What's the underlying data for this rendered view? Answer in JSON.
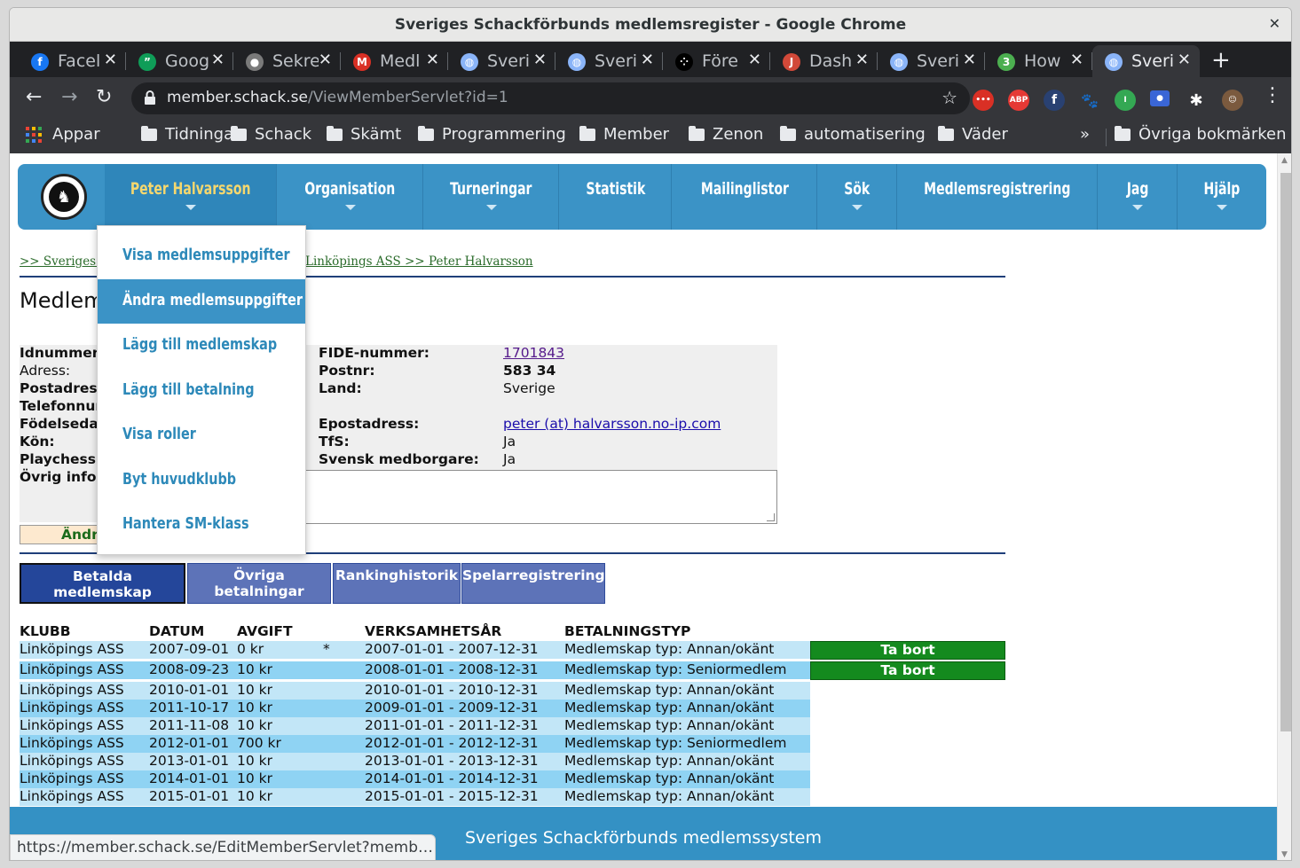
{
  "window": {
    "title": "Sveriges Schackförbunds medlemsregister - Google Chrome"
  },
  "tabs": [
    {
      "label": "Facel",
      "icon": "facebook-icon",
      "color": "#1877f2",
      "glyph": "f"
    },
    {
      "label": "Goog",
      "icon": "hangouts-icon",
      "color": "#0f9d58",
      "glyph": "”"
    },
    {
      "label": "Sekre",
      "icon": "user-group-icon",
      "color": "#7a7a7a",
      "glyph": "●"
    },
    {
      "label": "Medl",
      "icon": "member-icon",
      "color": "#d93025",
      "glyph": "M"
    },
    {
      "label": "Sveri",
      "icon": "globe-icon",
      "color": "#8ab4f8",
      "glyph": "◍"
    },
    {
      "label": "Sveri",
      "icon": "globe-icon",
      "color": "#8ab4f8",
      "glyph": "◍"
    },
    {
      "label": "Före",
      "icon": "dots-icon",
      "color": "#000000",
      "glyph": "⁘"
    },
    {
      "label": "Dash",
      "icon": "jenkins-icon",
      "color": "#d24939",
      "glyph": "J"
    },
    {
      "label": "Sveri",
      "icon": "globe-icon",
      "color": "#8ab4f8",
      "glyph": "◍"
    },
    {
      "label": "How",
      "icon": "speedtest-icon",
      "color": "#4caf50",
      "glyph": "3"
    },
    {
      "label": "Sveri",
      "icon": "globe-icon",
      "color": "#8ab4f8",
      "glyph": "◍",
      "active": true
    }
  ],
  "address": {
    "host": "member.schack.se",
    "path": "/ViewMemberServlet?id=1"
  },
  "bookmarks": {
    "apps": "Appar",
    "items": [
      "Tidningar",
      "Schack",
      "Skämt",
      "Programmering",
      "Member",
      "Zenon",
      "automatisering",
      "Väder"
    ],
    "more": "»",
    "other": "Övriga bokmärken"
  },
  "nav": {
    "items": [
      "Peter Halvarsson",
      "Organisation",
      "Turneringar",
      "Statistik",
      "Mailinglistor",
      "Sök",
      "Medlemsregistrering",
      "Jag",
      "Hjälp"
    ]
  },
  "dropdown": {
    "items": [
      "Visa medlemsuppgifter",
      "Ändra medlemsuppgifter",
      "Lägg till medlemskap",
      "Lägg till betalning",
      "Visa roller",
      "Byt huvudklubb",
      "Hantera SM-klass"
    ],
    "highlighted": 1
  },
  "breadcrumb": {
    "start": ">> Sveriges Sc",
    "end": "Linköpings ASS >> Peter Halvarsson"
  },
  "page_title": "Medlem",
  "member": {
    "left_labels": [
      "Idnummer:",
      "Adress:",
      "Postadress",
      "Telefonnum",
      "Födelsedat",
      "Kön:",
      "Playchess:",
      "Övrig info:"
    ],
    "fide_label": "FIDE-nummer:",
    "fide": "1701843",
    "postnr_label": "Postnr:",
    "postnr": "583 34",
    "land_label": "Land:",
    "land": "Sverige",
    "email_label": "Epostadress:",
    "email": "peter (at) halvarsson.no-ip.com",
    "tfs_label": "TfS:",
    "tfs": "Ja",
    "citizen_label": "Svensk medborgare:",
    "citizen": "Ja",
    "edit_button": "Ändra"
  },
  "page_tabs": [
    "Betalda medlemskap",
    "Övriga betalningar",
    "Rankinghistorik",
    "Spelarregistrering"
  ],
  "table": {
    "headers": [
      "KLUBB",
      "DATUM",
      "AVGIFT",
      "VERKSAMHETSÅR",
      "BETALNINGSTYP"
    ],
    "delete_label": "Ta bort",
    "rows": [
      {
        "club": "Linköpings ASS",
        "date": "2007-09-01",
        "fee": "0 kr",
        "mark": "*",
        "year": "2007-01-01 - 2007-12-31",
        "type": "Medlemskap typ: Annan/okänt",
        "deletable": true
      },
      {
        "club": "Linköpings ASS",
        "date": "2008-09-23",
        "fee": "10 kr",
        "mark": "",
        "year": "2008-01-01 - 2008-12-31",
        "type": "Medlemskap typ: Seniormedlem",
        "deletable": true
      },
      {
        "club": "Linköpings ASS",
        "date": "2010-01-01",
        "fee": "10 kr",
        "mark": "",
        "year": "2010-01-01 - 2010-12-31",
        "type": "Medlemskap typ: Annan/okänt"
      },
      {
        "club": "Linköpings ASS",
        "date": "2011-10-17",
        "fee": "10 kr",
        "mark": "",
        "year": "2009-01-01 - 2009-12-31",
        "type": "Medlemskap typ: Annan/okänt"
      },
      {
        "club": "Linköpings ASS",
        "date": "2011-11-08",
        "fee": "10 kr",
        "mark": "",
        "year": "2011-01-01 - 2011-12-31",
        "type": "Medlemskap typ: Annan/okänt"
      },
      {
        "club": "Linköpings ASS",
        "date": "2012-01-01",
        "fee": "700 kr",
        "mark": "",
        "year": "2012-01-01 - 2012-12-31",
        "type": "Medlemskap typ: Seniormedlem"
      },
      {
        "club": "Linköpings ASS",
        "date": "2013-01-01",
        "fee": "10 kr",
        "mark": "",
        "year": "2013-01-01 - 2013-12-31",
        "type": "Medlemskap typ: Annan/okänt"
      },
      {
        "club": "Linköpings ASS",
        "date": "2014-01-01",
        "fee": "10 kr",
        "mark": "",
        "year": "2014-01-01 - 2014-12-31",
        "type": "Medlemskap typ: Annan/okänt"
      },
      {
        "club": "Linköpings ASS",
        "date": "2015-01-01",
        "fee": "10 kr",
        "mark": "",
        "year": "2015-01-01 - 2015-12-31",
        "type": "Medlemskap typ: Annan/okänt"
      }
    ]
  },
  "footer": "Sveriges Schackförbunds medlemssystem",
  "status_url": "https://member.schack.se/EditMemberServlet?memb…"
}
